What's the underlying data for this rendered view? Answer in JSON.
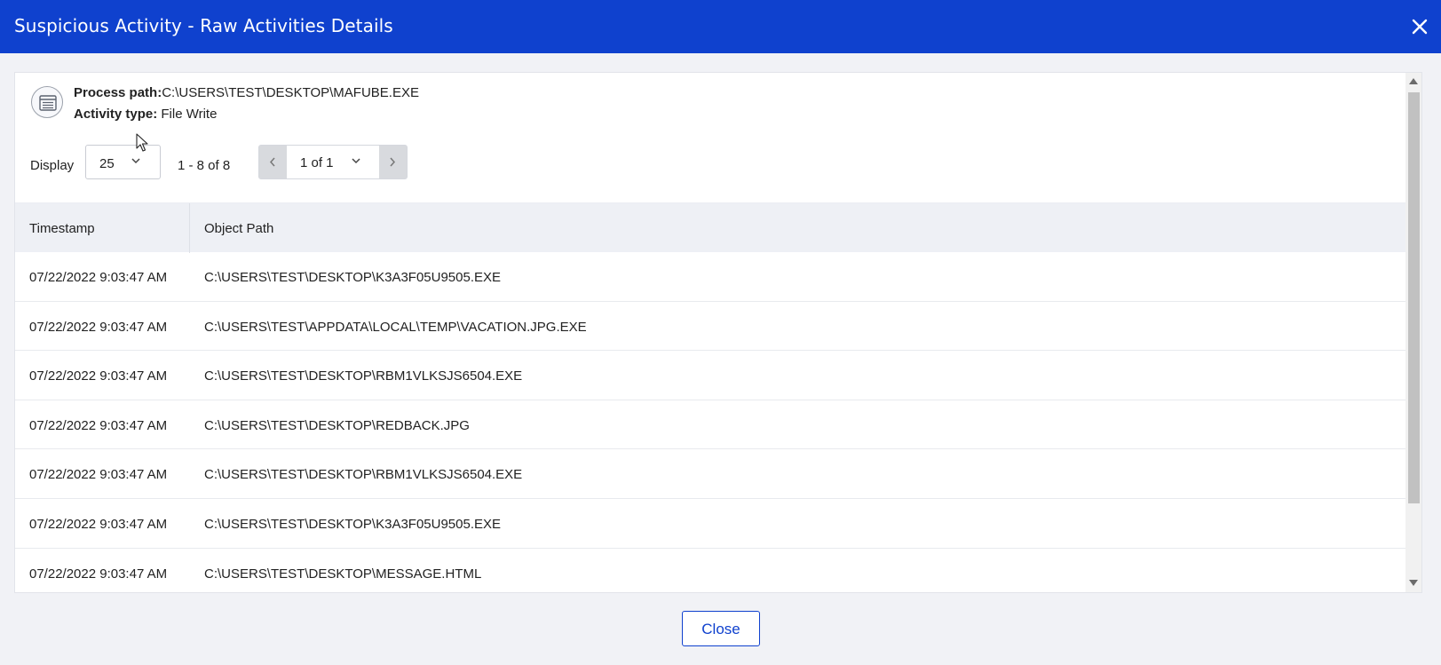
{
  "dialog": {
    "title": "Suspicious Activity - Raw Activities Details",
    "close_icon": "close-icon"
  },
  "process": {
    "icon": "list-document-icon",
    "path_label": "Process path:",
    "path_value": "C:\\USERS\\TEST\\DESKTOP\\MAFUBE.EXE",
    "activity_label": "Activity type:",
    "activity_value": " File Write"
  },
  "pagination": {
    "display_label": "Display",
    "page_size": "25",
    "range_text": "1 - 8 of 8",
    "page_indicator": "1 of 1",
    "prev_icon": "chevron-left-icon",
    "next_icon": "chevron-right-icon"
  },
  "table": {
    "columns": [
      "Timestamp",
      "Object Path"
    ],
    "rows": [
      {
        "timestamp": "07/22/2022 9:03:47 AM",
        "path": "C:\\USERS\\TEST\\DESKTOP\\K3A3F05U9505.EXE"
      },
      {
        "timestamp": "07/22/2022 9:03:47 AM",
        "path": "C:\\USERS\\TEST\\APPDATA\\LOCAL\\TEMP\\VACATION.JPG.EXE"
      },
      {
        "timestamp": "07/22/2022 9:03:47 AM",
        "path": "C:\\USERS\\TEST\\DESKTOP\\RBM1VLKSJS6504.EXE"
      },
      {
        "timestamp": "07/22/2022 9:03:47 AM",
        "path": "C:\\USERS\\TEST\\DESKTOP\\REDBACK.JPG"
      },
      {
        "timestamp": "07/22/2022 9:03:47 AM",
        "path": "C:\\USERS\\TEST\\DESKTOP\\RBM1VLKSJS6504.EXE"
      },
      {
        "timestamp": "07/22/2022 9:03:47 AM",
        "path": "C:\\USERS\\TEST\\DESKTOP\\K3A3F05U9505.EXE"
      },
      {
        "timestamp": "07/22/2022 9:03:47 AM",
        "path": "C:\\USERS\\TEST\\DESKTOP\\MESSAGE.HTML"
      }
    ]
  },
  "footer": {
    "close_label": "Close"
  },
  "colors": {
    "header_bg": "#0f41ce",
    "accent": "#0f41ce",
    "page_bg": "#f1f2f6",
    "table_header_bg": "#eef0f5"
  }
}
